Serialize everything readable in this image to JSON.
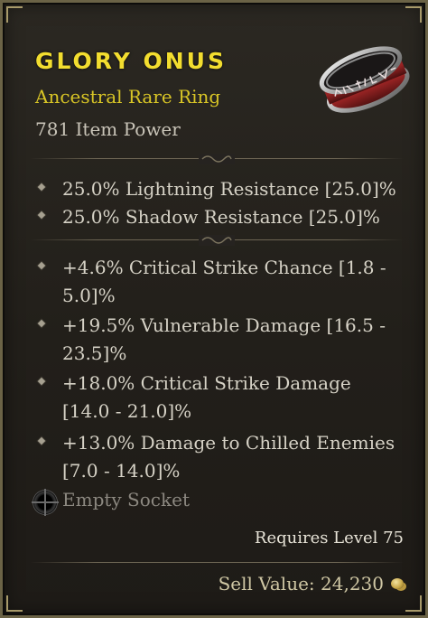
{
  "item": {
    "name": "GLORY ONUS",
    "type": "Ancestral Rare Ring",
    "power": "781 Item Power",
    "image_icon": "ring-icon"
  },
  "implicits": [
    "25.0% Lightning Resistance [25.0]%",
    "25.0% Shadow Resistance [25.0]%"
  ],
  "affixes": [
    "+4.6% Critical Strike Chance [1.8 - 5.0]%",
    "+19.5% Vulnerable Damage [16.5 - 23.5]%",
    "+18.0% Critical Strike Damage [14.0 - 21.0]%",
    "+13.0% Damage to Chilled Enemies [7.0 - 14.0]%"
  ],
  "socket": {
    "label": "Empty Socket",
    "icon": "empty-socket-icon"
  },
  "requirements": "Requires Level 75",
  "sell_value": "Sell Value: 24,230",
  "colors": {
    "name": "#f2dd2f",
    "type": "#d8c526",
    "text": "#d6d2c6",
    "border": "#6b6346"
  }
}
